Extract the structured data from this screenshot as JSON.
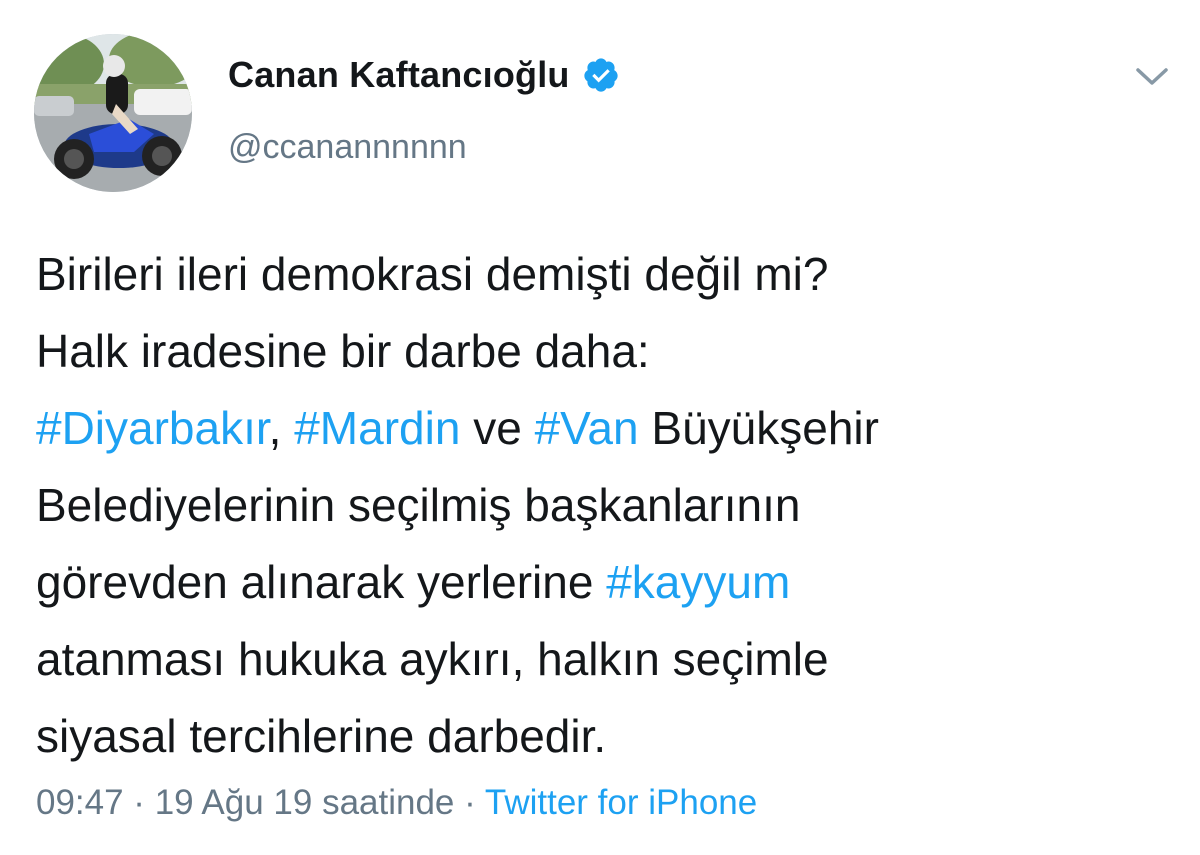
{
  "author": {
    "display_name": "Canan Kaftancıoğlu",
    "handle": "@ccanannnnnn",
    "verified": true
  },
  "icons": {
    "verified": "verified-badge-icon",
    "menu": "chevron-down-icon"
  },
  "tweet": {
    "lines": [
      [
        {
          "text": "Birileri ileri demokrasi demişti değil mi?",
          "type": "text"
        }
      ],
      [
        {
          "text": "Halk iradesine bir darbe daha:",
          "type": "text"
        }
      ],
      [
        {
          "text": "#Diyarbakır",
          "type": "hashtag"
        },
        {
          "text": ", ",
          "type": "text"
        },
        {
          "text": "#Mardin",
          "type": "hashtag"
        },
        {
          "text": " ve ",
          "type": "text"
        },
        {
          "text": "#Van",
          "type": "hashtag"
        },
        {
          "text": " Büyükşehir",
          "type": "text"
        }
      ],
      [
        {
          "text": "Belediyelerinin seçilmiş başkanlarının",
          "type": "text"
        }
      ],
      [
        {
          "text": "görevden alınarak yerlerine ",
          "type": "text"
        },
        {
          "text": "#kayyum",
          "type": "hashtag"
        }
      ],
      [
        {
          "text": "atanması hukuka aykırı, halkın seçimle",
          "type": "text"
        }
      ],
      [
        {
          "text": "siyasal tercihlerine darbedir.",
          "type": "text"
        }
      ]
    ]
  },
  "meta": {
    "timestamp": "09:47 · 19 Ağu 19 saatinde · ",
    "source": "Twitter for iPhone"
  },
  "colors": {
    "link": "#1da1f2",
    "text": "#14171a",
    "muted": "#657786",
    "background": "#ffffff"
  }
}
